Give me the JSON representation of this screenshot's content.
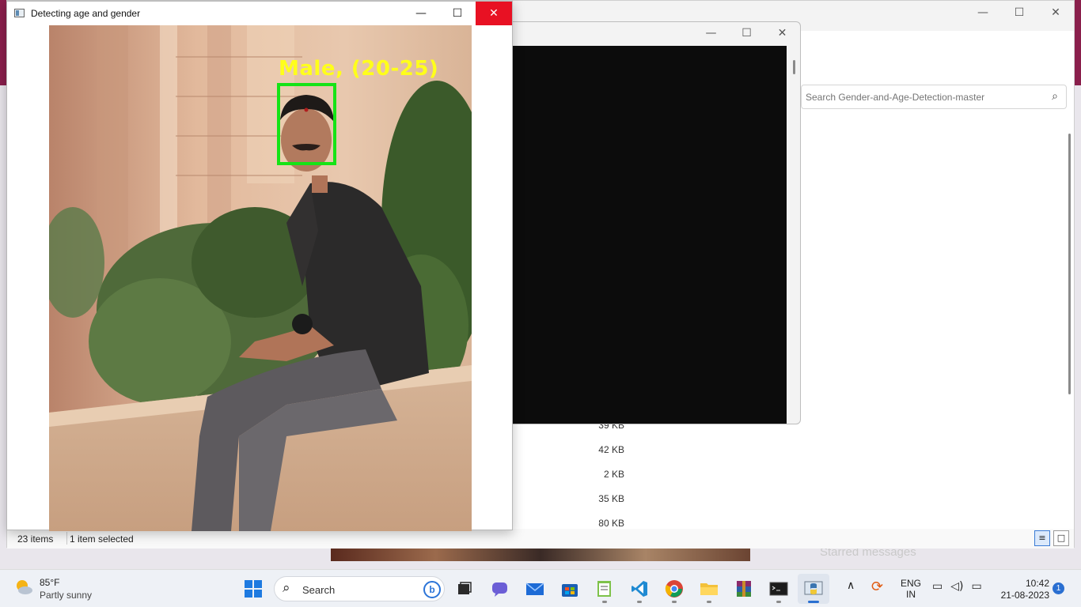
{
  "cv_window": {
    "title": "Detecting age and gender",
    "detection_label": "Male, (20-25)",
    "box_color": "#16e316",
    "label_color": "#ffff1a",
    "controls": {
      "minimize": "—",
      "maximize": "☐",
      "close": "✕"
    }
  },
  "console_window": {
    "controls": {
      "minimize": "—",
      "maximize": "☐",
      "close": "✕"
    }
  },
  "explorer": {
    "controls": {
      "minimize": "—",
      "maximize": "☐",
      "close": "✕"
    },
    "search_placeholder": "Search Gender-and-Age-Detection-master",
    "file_sizes": [
      "39 KB",
      "42 KB",
      "2 KB",
      "35 KB",
      "80 KB"
    ],
    "status": {
      "items": "23 items",
      "selected": "1 item selected"
    }
  },
  "desktop": {
    "ghost_text": "Starred messages"
  },
  "taskbar": {
    "weather": {
      "temp": "85°F",
      "desc": "Partly sunny"
    },
    "search_label": "Search",
    "apps": [
      "start-icon",
      "task-view-icon",
      "teams-chat-icon",
      "mail-icon",
      "store-icon",
      "notepad-icon",
      "vscode-icon",
      "chrome-icon",
      "file-explorer-icon",
      "winrar-icon",
      "terminal-icon",
      "python-icon"
    ],
    "tray": {
      "lang_line1": "ENG",
      "lang_line2": "IN",
      "time": "10:42",
      "date": "21-08-2023",
      "notification_count": "1"
    }
  }
}
